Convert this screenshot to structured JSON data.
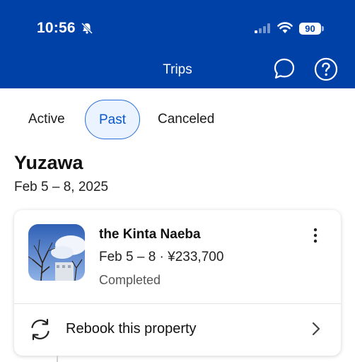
{
  "status_bar": {
    "time": "10:56",
    "battery": "90"
  },
  "header": {
    "title": "Trips"
  },
  "tabs": [
    {
      "label": "Active"
    },
    {
      "label": "Past"
    },
    {
      "label": "Canceled"
    }
  ],
  "trip": {
    "city": "Yuzawa",
    "dates": "Feb 5 – 8, 2025",
    "property": {
      "name": "the Kinta Naeba",
      "info": "Feb 5 – 8 · ¥233,700",
      "status": "Completed"
    },
    "rebook_label": "Rebook this property"
  },
  "colors": {
    "header_bg": "#0041a8",
    "accent": "#0a57c9",
    "active_tab_bg": "#eaf3ff"
  }
}
